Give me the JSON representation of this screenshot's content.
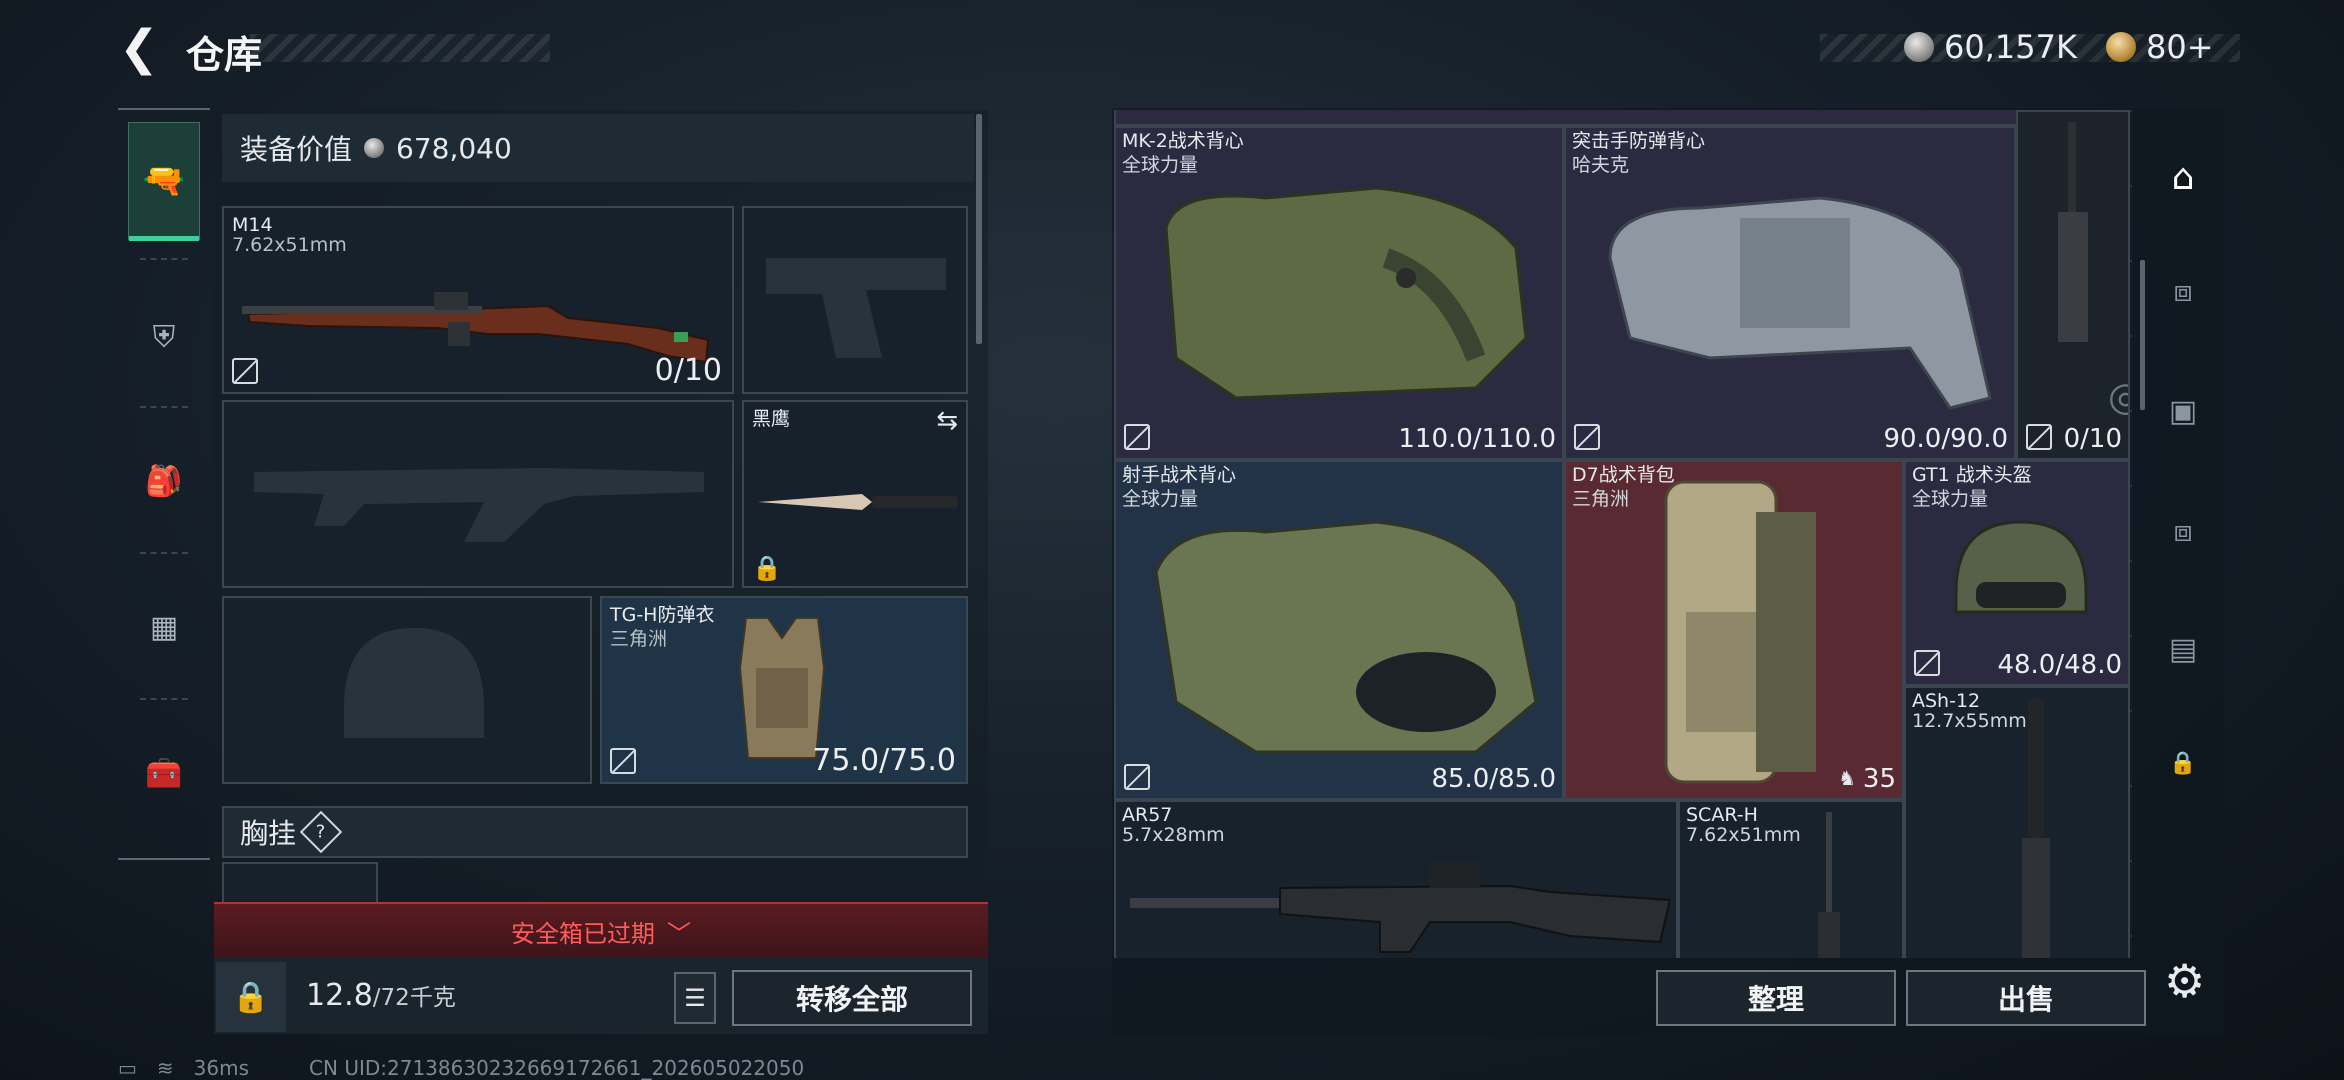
{
  "header": {
    "title": "仓库",
    "back_icon": "back-arrow-icon",
    "currency1": {
      "icon": "silver-coin-icon",
      "value": "60,157K"
    },
    "currency2": {
      "icon": "gold-coin-icon",
      "value": "80+"
    }
  },
  "left_nav": {
    "items": [
      {
        "icon": "pistol-icon",
        "active": true
      },
      {
        "icon": "armor-vest-icon"
      },
      {
        "icon": "backpack-icon"
      },
      {
        "icon": "chest-rig-icon"
      },
      {
        "icon": "toolbox-icon"
      }
    ]
  },
  "loadout": {
    "value_label": "装备价值",
    "value": "678,040",
    "primary": {
      "name": "M14",
      "caliber": "7.62x51mm",
      "ammo": "0/10"
    },
    "melee": {
      "name": "黑鹰"
    },
    "armor": {
      "name": "TG-H防弹衣",
      "origin": "三角洲",
      "durability": "75.0/75.0"
    },
    "chest_section": "胸挂",
    "help": "?",
    "safebox_status": "安全箱已过期",
    "weight": "12.8",
    "weight_max": "/72千克",
    "transfer_all": "转移全部"
  },
  "storage": {
    "items": [
      {
        "name": "MK-2战术背心",
        "origin": "全球力量",
        "durability": "110.0/110.0",
        "color": "purple"
      },
      {
        "name": "突击手防弹背心",
        "origin": "哈夫克",
        "durability": "90.0/90.0",
        "color": "purple"
      },
      {
        "name": "",
        "durability": "0/10",
        "color": "purple"
      },
      {
        "name": "射手战术背心",
        "origin": "全球力量",
        "durability": "85.0/85.0",
        "color": "blue"
      },
      {
        "name": "D7战术背包",
        "origin": "三角洲",
        "capacity": "35",
        "color": "red"
      },
      {
        "name": "GT1 战术头盔",
        "origin": "全球力量",
        "durability": "48.0/48.0",
        "color": "purple"
      },
      {
        "name": "ASh-12",
        "origin": "12.7x55mm",
        "color": "dark"
      },
      {
        "name": "AR57",
        "origin": "5.7x28mm",
        "color": "dark"
      },
      {
        "name": "SCAR-H",
        "origin": "7.62x51mm",
        "color": "dark"
      }
    ],
    "sort_button": "整理",
    "sell_button": "出售"
  },
  "right_nav": {
    "items": [
      "safe-icon",
      "container-icon",
      "camera-case-icon",
      "case-icon",
      "video-case-icon",
      "lock-icon"
    ]
  },
  "status_bar": {
    "ping": "36ms",
    "uid": "CN UID:271386302326691726​61_202605022050"
  }
}
